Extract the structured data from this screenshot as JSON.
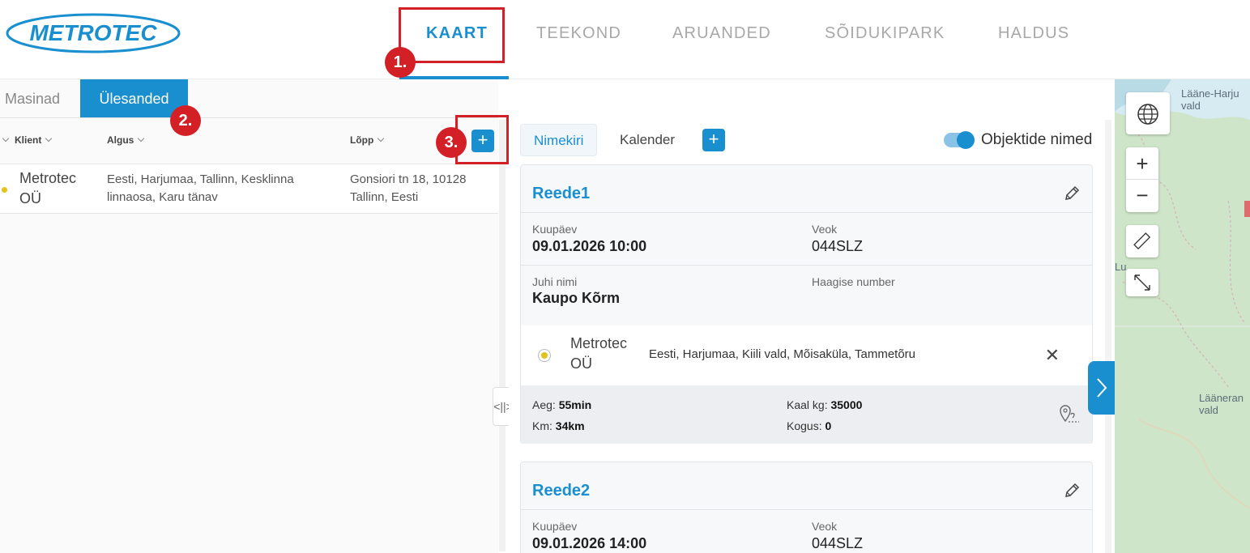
{
  "header": {
    "logo_text": "METROTEC",
    "nav": [
      {
        "label": "KAART",
        "active": true
      },
      {
        "label": "TEEKOND",
        "active": false
      },
      {
        "label": "ARUANDED",
        "active": false
      },
      {
        "label": "SÕIDUKIPARK",
        "active": false
      },
      {
        "label": "HALDUS",
        "active": false
      }
    ]
  },
  "annotations": [
    "1.",
    "2.",
    "3."
  ],
  "left": {
    "tabs": [
      {
        "label": "Masinad",
        "active": false
      },
      {
        "label": "Ülesanded",
        "active": true
      }
    ],
    "columns": [
      "Klient",
      "Algus",
      "Lõpp"
    ],
    "add_label": "+",
    "rows": [
      {
        "client": "Metrotec OÜ",
        "start": "Eesti, Harjumaa, Tallinn, Kesklinna linnaosa, Karu tänav",
        "end": "Gonsiori tn 18, 10128 Tallinn, Eesti",
        "status_color": "#e2c21c"
      }
    ]
  },
  "middle": {
    "tabs": [
      {
        "label": "Nimekiri",
        "active": true
      },
      {
        "label": "Kalender",
        "active": false
      }
    ],
    "add_label": "+",
    "toggle": {
      "label": "Objektide nimed",
      "on": true
    },
    "cards": [
      {
        "title": "Reede1",
        "date_label": "Kuupäev",
        "date": "09.01.2026 10:00",
        "vehicle_label": "Veok",
        "vehicle": "044SLZ",
        "driver_label": "Juhi nimi",
        "driver": "Kaupo Kõrm",
        "trailer_label": "Haagise number",
        "trailer": "",
        "stop": {
          "client": "Metrotec OÜ",
          "address": "Eesti, Harjumaa, Kiili vald, Mõisaküla, Tammetõru"
        },
        "stats": {
          "time_label": "Aeg:",
          "time": "55min",
          "km_label": "Km:",
          "km": "34km",
          "weight_label": "Kaal kg:",
          "weight": "35000",
          "qty_label": "Kogus:",
          "qty": "0"
        }
      },
      {
        "title": "Reede2",
        "date_label": "Kuupäev",
        "date": "09.01.2026 14:00",
        "vehicle_label": "Veok",
        "vehicle": "044SLZ"
      }
    ]
  },
  "map": {
    "labels": [
      "Lääne-Harju vald",
      "Lu",
      "Lääneran vald"
    ],
    "controls": [
      "globe-icon",
      "zoom-in-icon",
      "zoom-out-icon",
      "ruler-icon",
      "fullscreen-icon"
    ]
  },
  "colors": {
    "accent": "#1a8fd0",
    "annotation": "#d32027",
    "status": "#e2c21c"
  }
}
